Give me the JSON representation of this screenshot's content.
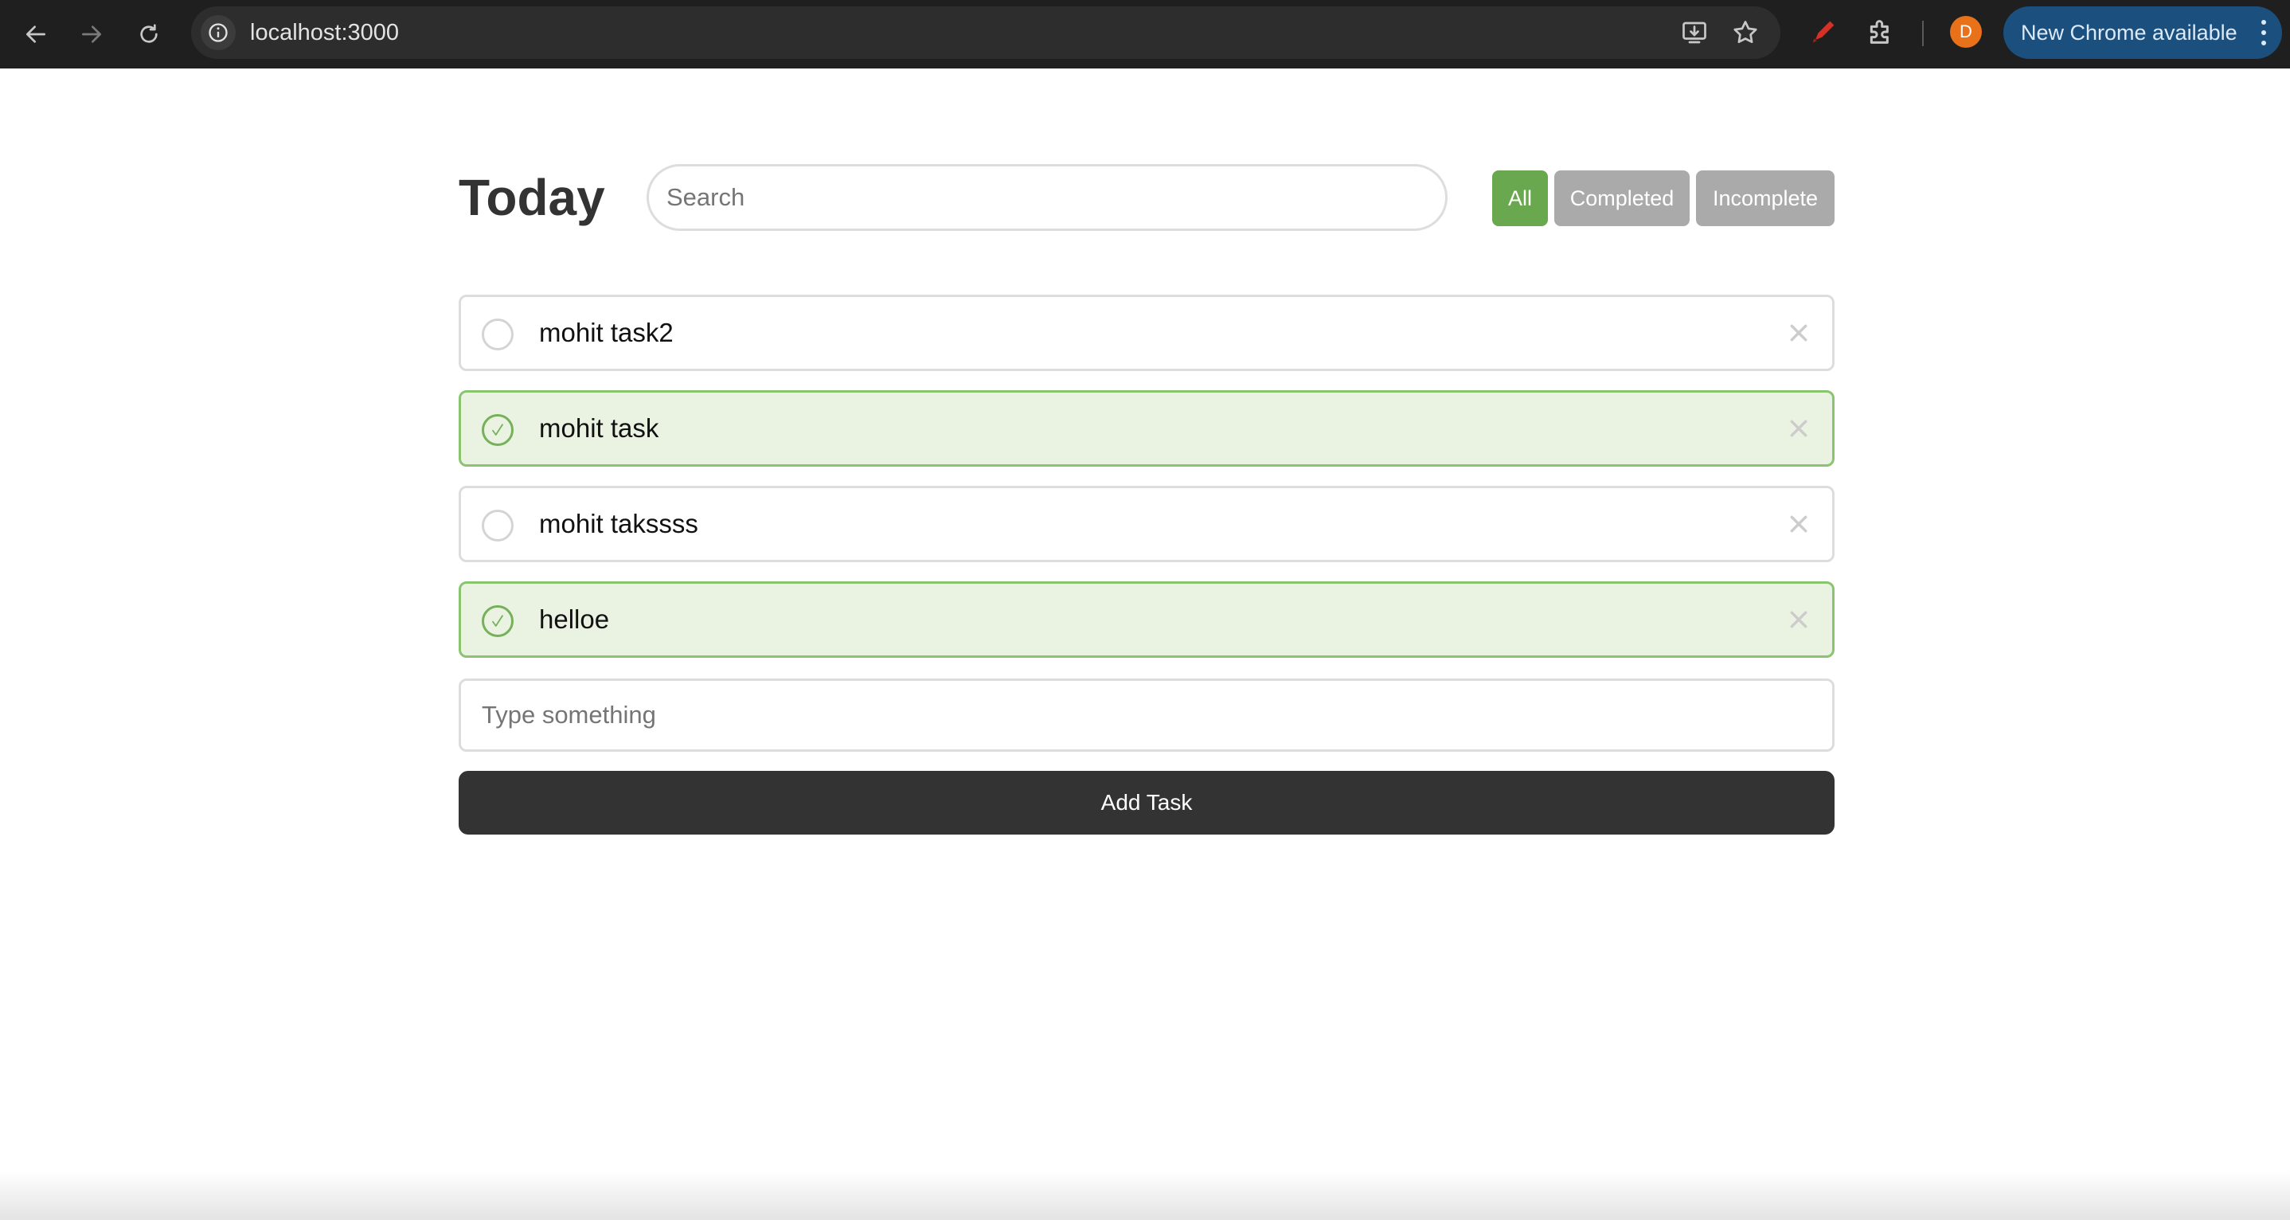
{
  "browser": {
    "url": "localhost:3000",
    "profile_initial": "D",
    "update_label": "New Chrome available"
  },
  "app": {
    "title": "Today",
    "search": {
      "placeholder": "Search",
      "value": ""
    },
    "filters": [
      {
        "label": "All",
        "active": true
      },
      {
        "label": "Completed",
        "active": false
      },
      {
        "label": "Incomplete",
        "active": false
      }
    ],
    "tasks": [
      {
        "text": "mohit task2",
        "completed": false
      },
      {
        "text": "mohit task",
        "completed": true
      },
      {
        "text": "mohit takssss",
        "completed": false
      },
      {
        "text": "helloe",
        "completed": true
      }
    ],
    "new_task": {
      "placeholder": "Type something",
      "value": ""
    },
    "add_button_label": "Add Task"
  },
  "colors": {
    "accent_green": "#6aa84f",
    "filter_inactive": "#aaaaaa",
    "completed_bg": "#eaf3e2",
    "completed_border": "#8bc470",
    "button_dark": "#333333"
  }
}
